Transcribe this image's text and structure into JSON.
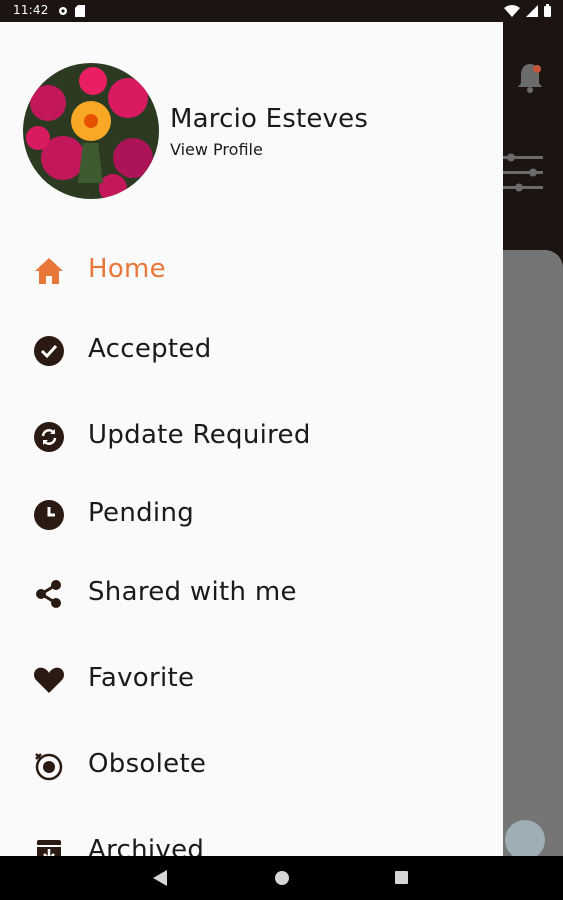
{
  "status": {
    "time": "11:42"
  },
  "profile": {
    "name": "Marcio Esteves",
    "link_label": "View Profile"
  },
  "menu": [
    {
      "label": "Home",
      "icon": "home-icon",
      "active": true
    },
    {
      "label": "Accepted",
      "icon": "check-circle-icon"
    },
    {
      "label": "Update Required",
      "icon": "sync-circle-icon"
    },
    {
      "label": "Pending",
      "icon": "clock-icon"
    },
    {
      "label": "Shared with me",
      "icon": "share-icon"
    },
    {
      "label": "Favorite",
      "icon": "heart-icon"
    },
    {
      "label": "Obsolete",
      "icon": "obsolete-timer-icon"
    },
    {
      "label": "Archived",
      "icon": "archive-icon"
    }
  ],
  "colors": {
    "accent": "#e8773a",
    "icon_dark": "#2a1a12",
    "drawer_bg": "#fafafa",
    "header_bg": "#1b1410"
  }
}
